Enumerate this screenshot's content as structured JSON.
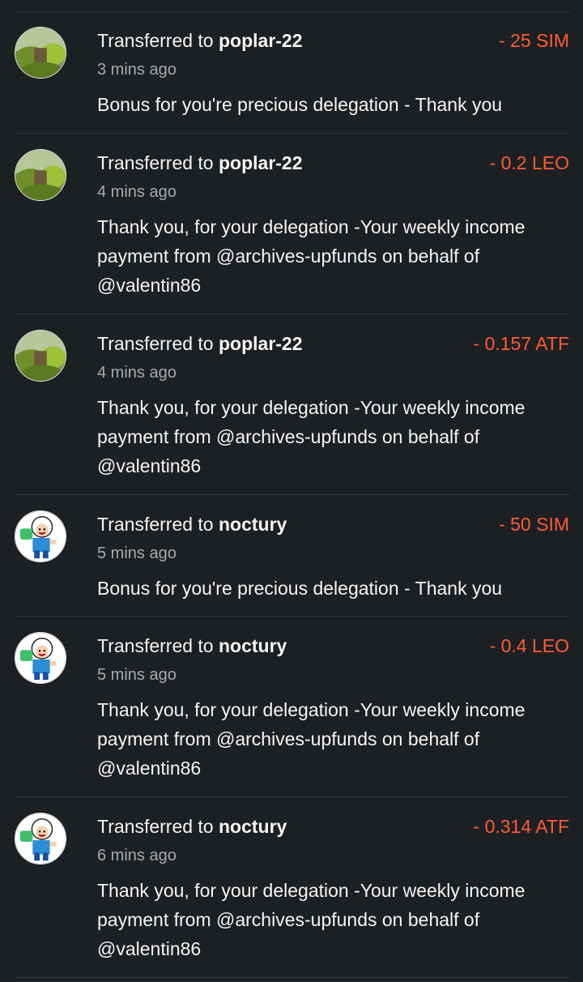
{
  "transactions": [
    {
      "avatar": "landscape-avatar-icon",
      "prefix": "Transferred to ",
      "user": "poplar-22",
      "amount": "- 25 SIM",
      "time": "3 mins ago",
      "memo": "Bonus for you're precious delegation - Thank you"
    },
    {
      "avatar": "landscape-avatar-icon",
      "prefix": "Transferred to ",
      "user": "poplar-22",
      "amount": "- 0.2 LEO",
      "time": "4 mins ago",
      "memo": "Thank you, for your delegation -Your weekly income payment from @archives-upfunds on behalf of @valentin86"
    },
    {
      "avatar": "landscape-avatar-icon",
      "prefix": "Transferred to ",
      "user": "poplar-22",
      "amount": "- 0.157 ATF",
      "time": "4 mins ago",
      "memo": "Thank you, for your delegation -Your weekly income payment from @archives-upfunds on behalf of @valentin86"
    },
    {
      "avatar": "cartoon-avatar-icon",
      "prefix": "Transferred to ",
      "user": "noctury",
      "amount": "- 50 SIM",
      "time": "5 mins ago",
      "memo": "Bonus for you're precious delegation - Thank you"
    },
    {
      "avatar": "cartoon-avatar-icon",
      "prefix": "Transferred to ",
      "user": "noctury",
      "amount": "- 0.4 LEO",
      "time": "5 mins ago",
      "memo": "Thank you, for your delegation -Your weekly income payment from @archives-upfunds on behalf of @valentin86"
    },
    {
      "avatar": "cartoon-avatar-icon",
      "prefix": "Transferred to ",
      "user": "noctury",
      "amount": "- 0.314 ATF",
      "time": "6 mins ago",
      "memo": "Thank you, for your delegation -Your weekly income payment from @archives-upfunds on behalf of @valentin86"
    }
  ],
  "colors": {
    "background": "#1d2023",
    "amount": "#ff5a36",
    "muted_text": "#a6a9ad",
    "divider": "#33373b"
  }
}
